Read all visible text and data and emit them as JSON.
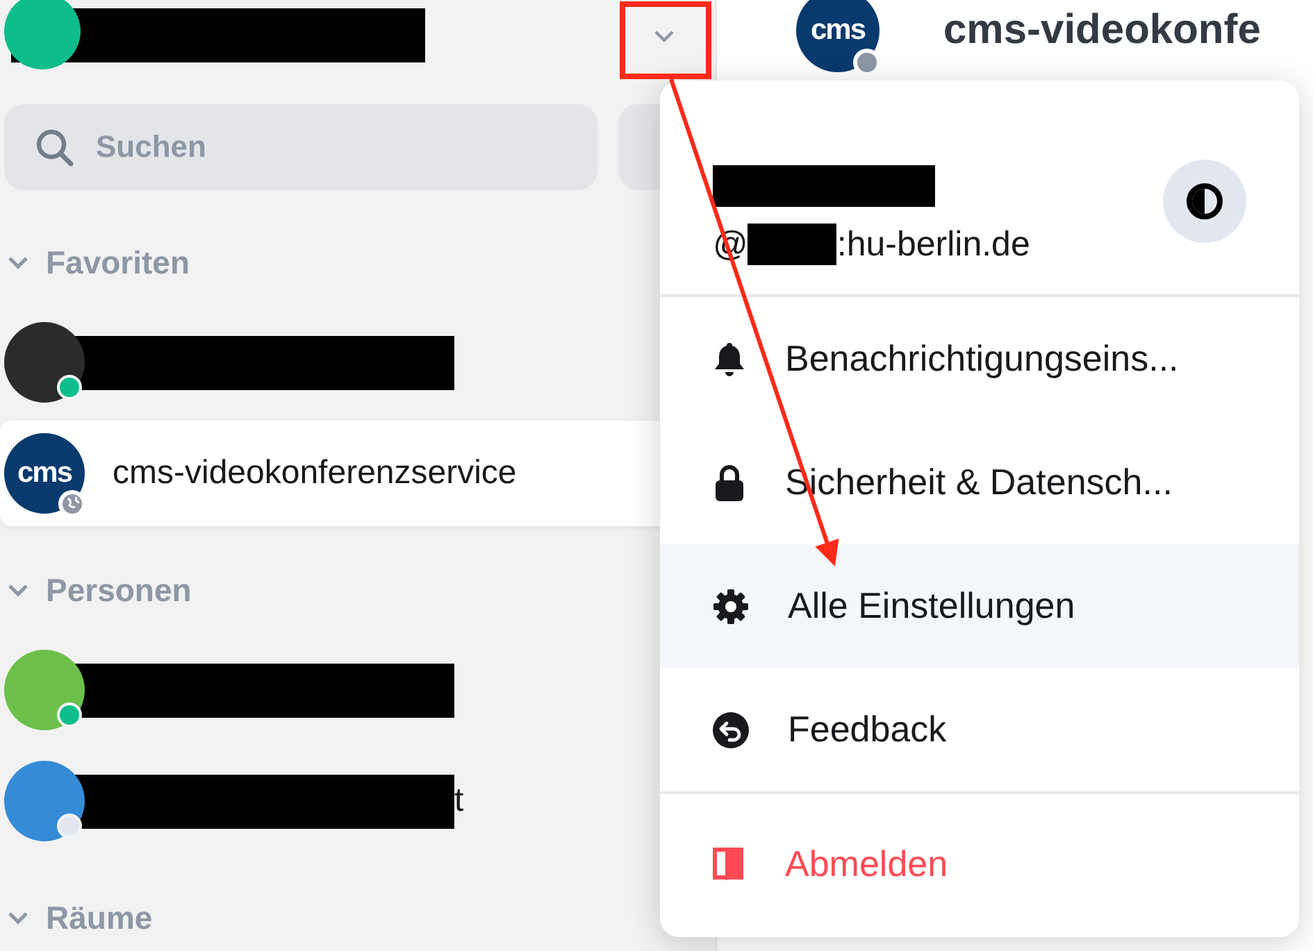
{
  "sidebar": {
    "search": {
      "placeholder": "Suchen"
    },
    "sections": [
      {
        "title": "Favoriten",
        "expanded": true,
        "rooms": [
          {
            "kind": "photo",
            "online": true,
            "selected": false
          },
          {
            "kind": "logo",
            "avatar_text": "cms",
            "name": "cms-videokonferenzservice",
            "public": true,
            "selected": true
          }
        ]
      },
      {
        "title": "Personen",
        "expanded": true,
        "rooms": [
          {
            "kind": "color",
            "color": "#6cc04a",
            "online": true,
            "selected": false
          },
          {
            "kind": "color",
            "color": "#368bd6",
            "name_tail": "t",
            "online": false,
            "selected": false
          }
        ]
      },
      {
        "title": "Räume",
        "expanded": true
      }
    ]
  },
  "main": {
    "avatar_text": "cms",
    "title": "cms-videokonfe"
  },
  "menu": {
    "user": {
      "id_prefix": "@",
      "id_suffix": ":hu-berlin.de"
    },
    "groups": [
      [
        {
          "kind": "bell",
          "label": "Benachrichtigungseins...",
          "selected": false
        },
        {
          "kind": "lock",
          "label": "Sicherheit & Datensch...",
          "selected": false
        },
        {
          "kind": "gear",
          "label": "Alle Einstellungen",
          "selected": true
        },
        {
          "kind": "feedback",
          "label": "Feedback",
          "selected": false
        }
      ],
      [
        {
          "kind": "signout",
          "label": "Abmelden",
          "selected": false
        }
      ]
    ]
  }
}
